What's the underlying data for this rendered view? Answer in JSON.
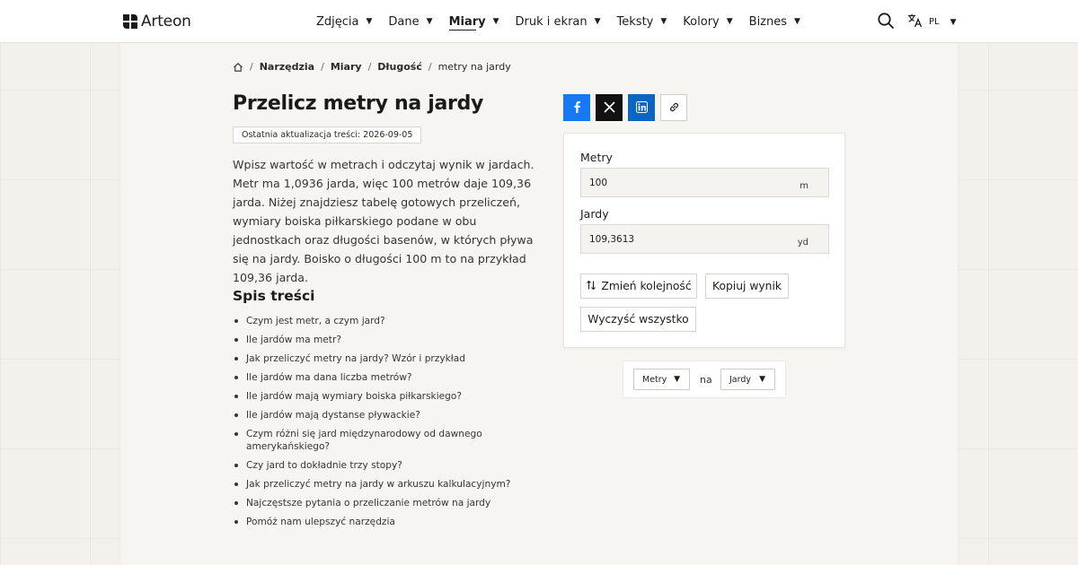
{
  "header": {
    "logo_text": "Arteon",
    "nav": [
      {
        "label": "Zdjęcia",
        "active": false
      },
      {
        "label": "Dane",
        "active": false
      },
      {
        "label": "Miary",
        "active": true
      },
      {
        "label": "Druk i ekran",
        "active": false
      },
      {
        "label": "Teksty",
        "active": false
      },
      {
        "label": "Kolory",
        "active": false
      },
      {
        "label": "Biznes",
        "active": false
      }
    ],
    "search_icon": "search-icon",
    "language": {
      "icon": "translate-icon",
      "code": "PL"
    }
  },
  "breadcrumb": {
    "home_icon": "home-icon",
    "items": [
      "Narzędzia",
      "Miary",
      "Długość",
      "metry na jardy"
    ]
  },
  "page": {
    "title": "Przelicz metry na jardy",
    "updated": "Ostatnia aktualizacja treści: 2026-09-05",
    "intro": "Wpisz wartość w metrach i odczytaj wynik w jardach. Metr ma 1,0936 jarda, więc 100 metrów daje 109,36 jarda. Niżej znajdziesz tabelę gotowych przeliczeń, wymiary boiska piłkarskiego podane w obu jednostkach oraz długości basenów, w których pływa się na jardy. Boisko o długości 100 m to na przykład 109,36 jarda."
  },
  "toc": {
    "title": "Spis treści",
    "items": [
      "Czym jest metr, a czym jard?",
      "Ile jardów ma metr?",
      "Jak przeliczyć metry na jardy? Wzór i przykład",
      "Ile jardów ma dana liczba metrów?",
      "Ile jardów mają wymiary boiska piłkarskiego?",
      "Ile jardów mają dystanse pływackie?",
      "Czym różni się jard międzynarodowy od dawnego amerykańskiego?",
      "Czy jard to dokładnie trzy stopy?",
      "Jak przeliczyć metry na jardy w arkuszu kalkulacyjnym?",
      "Najczęstsze pytania o przeliczanie metrów na jardy",
      "Pomóż nam ulepszyć narzędzia"
    ]
  },
  "share": {
    "icons": [
      "facebook-icon",
      "x-icon",
      "linkedin-icon",
      "link-icon"
    ],
    "colors": {
      "facebook": "#1877f2",
      "x": "#111111",
      "linkedin": "#0a66c2"
    }
  },
  "converter": {
    "from_label": "Metry",
    "from_value": "100",
    "from_unit": "m",
    "to_label": "Jardy",
    "to_value": "109,3613",
    "to_unit": "yd",
    "swap_label": "Zmień kolejność",
    "copy_label": "Kopiuj wynik",
    "clear_label": "Wyczyść wszystko"
  },
  "unit_picker": {
    "from": "Metry",
    "connector": "na",
    "to": "Jardy"
  }
}
